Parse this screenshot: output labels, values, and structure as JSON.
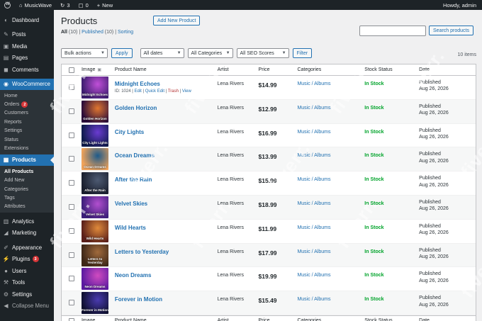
{
  "adminbar": {
    "site_name": "MusicWave",
    "updates_count": "3",
    "comments_count": "0",
    "new_label": "New",
    "howdy": "Howdy, admin"
  },
  "sidebar": {
    "items": [
      {
        "label": "Dashboard",
        "icon": "dashboard-icon"
      },
      {
        "label": "Posts",
        "icon": "pin-icon"
      },
      {
        "label": "Media",
        "icon": "media-icon"
      },
      {
        "label": "Pages",
        "icon": "page-icon"
      },
      {
        "label": "Comments",
        "icon": "comment-icon"
      },
      {
        "label": "WooCommerce",
        "icon": "woo-icon"
      }
    ],
    "woo_sub": [
      {
        "label": "Home"
      },
      {
        "label": "Orders",
        "badge": "2"
      },
      {
        "label": "Customers"
      },
      {
        "label": "Reports"
      },
      {
        "label": "Settings"
      },
      {
        "label": "Status"
      },
      {
        "label": "Extensions"
      }
    ],
    "products": {
      "label": "Products",
      "icon": "products-icon"
    },
    "products_sub": [
      {
        "label": "All Products"
      },
      {
        "label": "Add New"
      },
      {
        "label": "Categories"
      },
      {
        "label": "Tags"
      },
      {
        "label": "Attributes"
      }
    ],
    "lower": [
      {
        "label": "Analytics",
        "icon": "analytics-icon"
      },
      {
        "label": "Marketing",
        "icon": "megaphone-icon"
      },
      {
        "label": "Appearance",
        "icon": "brush-icon"
      },
      {
        "label": "Plugins",
        "icon": "plugin-icon",
        "badge": "3"
      },
      {
        "label": "Users",
        "icon": "user-icon"
      },
      {
        "label": "Tools",
        "icon": "wrench-icon"
      },
      {
        "label": "Settings",
        "icon": "settings-icon"
      },
      {
        "label": "Collapse Menu",
        "icon": "collapse-icon"
      }
    ]
  },
  "page": {
    "title": "Products",
    "add_new": "Add New Product",
    "views": {
      "all": "All",
      "all_count": "(10)",
      "published": "Published",
      "published_count": "(10)",
      "sorting": "Sorting",
      "sep": "|"
    },
    "search_button": "Search products",
    "bulk_actions": "Bulk actions",
    "apply": "Apply",
    "all_dates": "All dates",
    "all_categories": "All Categories",
    "seo_scores": "All SEO Scores",
    "filter": "Filter",
    "items_count": "10 items"
  },
  "table": {
    "headers": {
      "image": "Image",
      "name": "Product Name",
      "artist": "Artist",
      "price": "Price",
      "categories": "Categories",
      "stock": "Stock Status",
      "date": "Date"
    },
    "row_actions": {
      "id": "ID: 1024",
      "edit": "Edit",
      "quick_edit": "Quick Edit",
      "trash": "Trash",
      "view": "View",
      "sep": "|"
    },
    "rows": [
      {
        "name": "Midnight Echoes",
        "artist": "Lena Rivers",
        "price": "$14.99",
        "category": "Music / Albums",
        "stock": "In Stock",
        "status": "Published",
        "date": "Aug 26, 2026",
        "thumb_text": "Midnight Echoes",
        "c1": "#3b1d6e",
        "c2": "#c04fd8"
      },
      {
        "name": "Golden Horizon",
        "artist": "Lena Rivers",
        "price": "$12.99",
        "category": "Music / Albums",
        "stock": "In Stock",
        "status": "Published",
        "date": "Aug 26, 2026",
        "thumb_text": "Golden Horizon",
        "c1": "#2a0c3a",
        "c2": "#e0762f"
      },
      {
        "name": "City Lights",
        "artist": "Lena Rivers",
        "price": "$16.99",
        "category": "Music / Albums",
        "stock": "In Stock",
        "status": "Published",
        "date": "Aug 26, 2026",
        "thumb_text": "City Light Lights",
        "c1": "#0d1a4a",
        "c2": "#6a3bd1"
      },
      {
        "name": "Ocean Dreams",
        "artist": "Lena Rivers",
        "price": "$13.99",
        "category": "Music / Albums",
        "stock": "In Stock",
        "status": "Published",
        "date": "Aug 26, 2026",
        "thumb_text": "Ocean Dreams",
        "c1": "#f0a35a",
        "c2": "#1d5a8a"
      },
      {
        "name": "After the Rain",
        "artist": "Lena Rivers",
        "price": "$15.99",
        "category": "Music / Albums",
        "stock": "In Stock",
        "status": "Published",
        "date": "Aug 26, 2026",
        "thumb_text": "After the Rain",
        "c1": "#1a1f2e",
        "c2": "#4d5a72"
      },
      {
        "name": "Velvet Skies",
        "artist": "Lena Rivers",
        "price": "$18.99",
        "category": "Music / Albums",
        "stock": "In Stock",
        "status": "Published",
        "date": "Aug 26, 2026",
        "thumb_text": "Velvet Skies",
        "c1": "#3a1e78",
        "c2": "#b24fcf"
      },
      {
        "name": "Wild Hearts",
        "artist": "Lena Rivers",
        "price": "$11.99",
        "category": "Music / Albums",
        "stock": "In Stock",
        "status": "Published",
        "date": "Aug 26, 2026",
        "thumb_text": "Wild Hearts",
        "c1": "#5a1f1a",
        "c2": "#e08a3a"
      },
      {
        "name": "Letters to Yesterday",
        "artist": "Lena Rivers",
        "price": "$17.99",
        "category": "Music / Albums",
        "stock": "In Stock",
        "status": "Published",
        "date": "Aug 26, 2026",
        "thumb_text": "Letters to Yesterday",
        "c1": "#3d2617",
        "c2": "#a06a3c"
      },
      {
        "name": "Neon Dreams",
        "artist": "Lena Rivers",
        "price": "$19.99",
        "category": "Music / Albums",
        "stock": "In Stock",
        "status": "Published",
        "date": "Aug 26, 2026",
        "thumb_text": "Neon Dreams",
        "c1": "#5a1aa0",
        "c2": "#d04bc0"
      },
      {
        "name": "Forever in Motion",
        "artist": "Lena Rivers",
        "price": "$15.49",
        "category": "Music / Albums",
        "stock": "In Stock",
        "status": "Published",
        "date": "Aug 26, 2026",
        "thumb_text": "Forever in Motion",
        "c1": "#0f1030",
        "c2": "#4a3bb0"
      }
    ]
  },
  "watermark": "fiverr.",
  "colors": {
    "accent": "#2271b1",
    "sidebar": "#1d2327",
    "instock": "#00a32a",
    "danger": "#d63638"
  }
}
